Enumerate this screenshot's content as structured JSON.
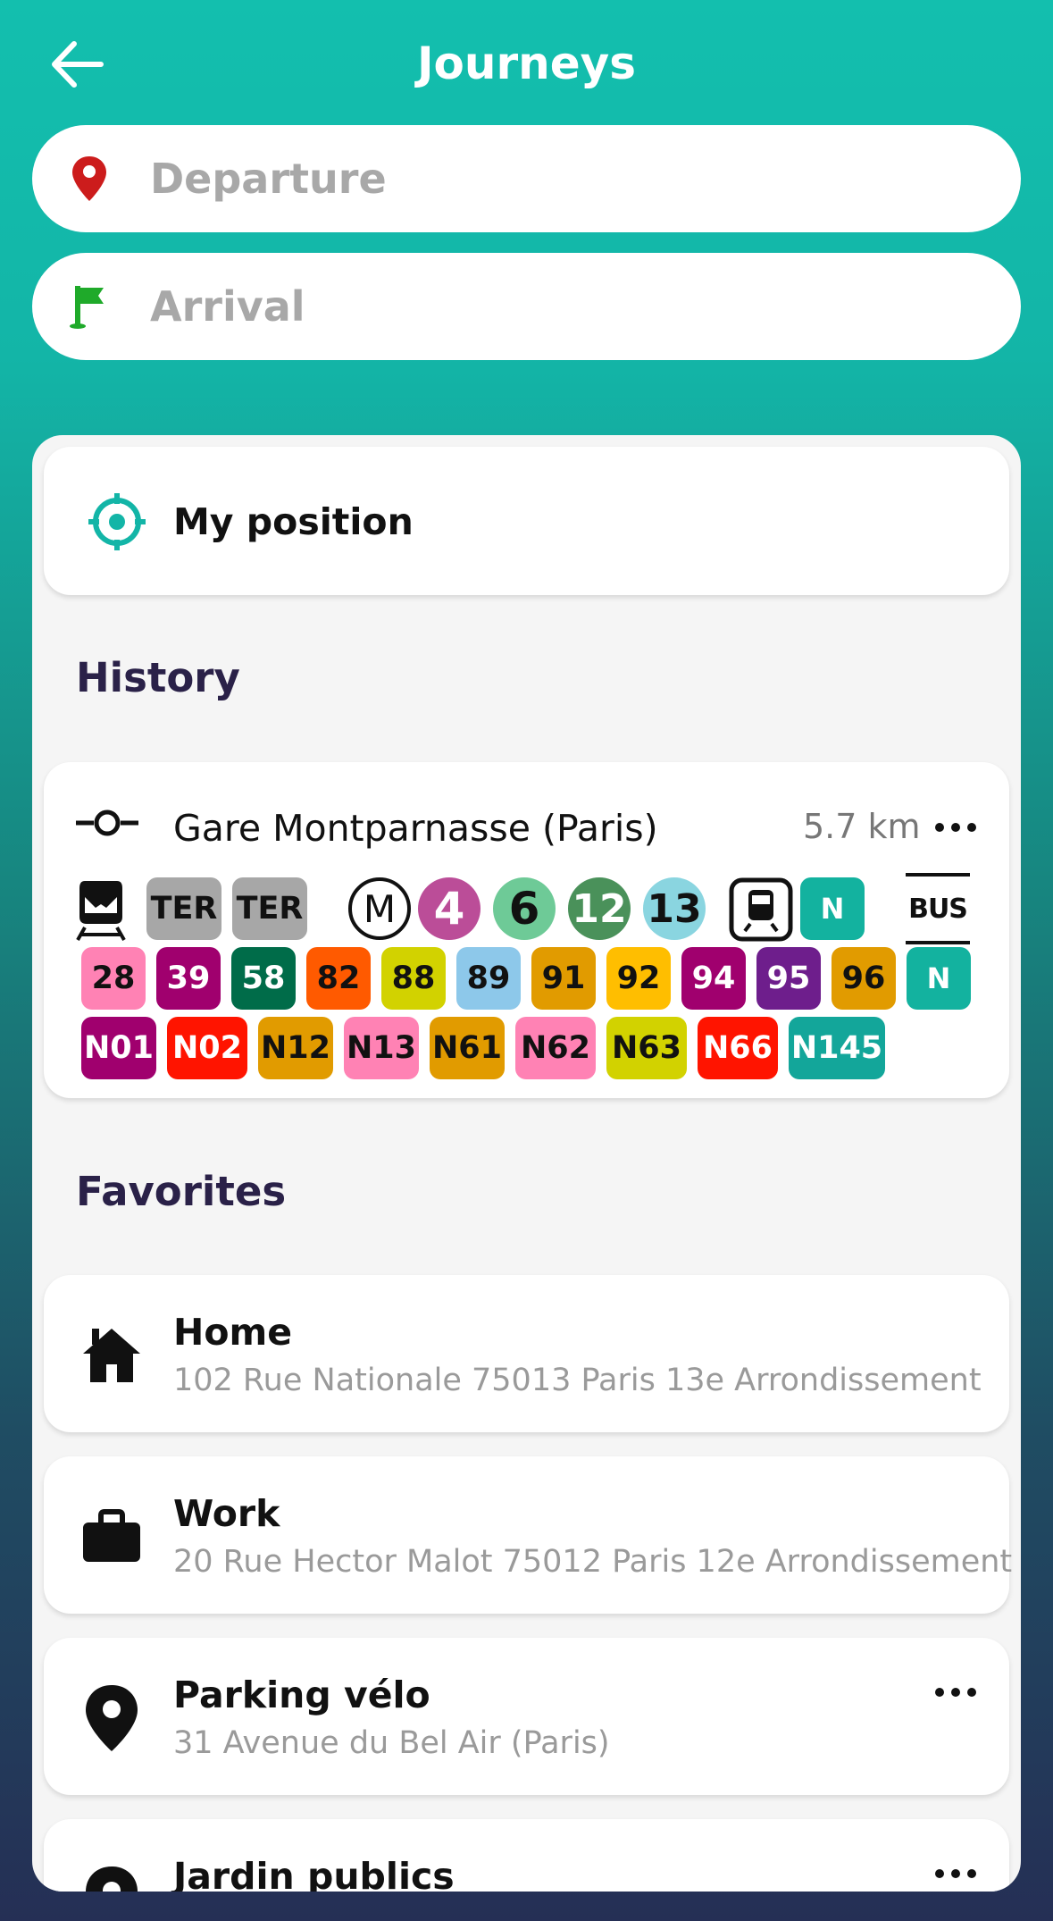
{
  "header": {
    "title": "Journeys",
    "back_icon": "arrow-left-icon"
  },
  "search": {
    "departure_placeholder": "Departure",
    "arrival_placeholder": "Arrival",
    "departure_icon": "map-pin-icon",
    "arrival_icon": "flag-icon"
  },
  "my_position": {
    "label": "My position",
    "icon": "crosshair-icon"
  },
  "history": {
    "title": "History",
    "items": [
      {
        "name": "Gare Montparnasse (Paris)",
        "distance": "5.7 km",
        "icon": "station-icon",
        "rer_lines": [
          "TER",
          "TER"
        ],
        "metro_lines": [
          {
            "label": "4",
            "color": "#bb4d98",
            "text": "#ffffff"
          },
          {
            "label": "6",
            "color": "#6eca97",
            "text": "#111111"
          },
          {
            "label": "12",
            "color": "#4a915a",
            "text": "#ffffff"
          },
          {
            "label": "13",
            "color": "#8ad5e0",
            "text": "#111111"
          }
        ],
        "tram_line": {
          "label": "N",
          "color": "#13b29f"
        },
        "bus_label": "BUS",
        "bus_lines": [
          {
            "label": "28",
            "color": "#ff82b4",
            "text": "#111111"
          },
          {
            "label": "39",
            "color": "#a0006e",
            "text": "#ffffff"
          },
          {
            "label": "58",
            "color": "#006c49",
            "text": "#ffffff"
          },
          {
            "label": "82",
            "color": "#ff5a00",
            "text": "#111111"
          },
          {
            "label": "88",
            "color": "#d2d200",
            "text": "#111111"
          },
          {
            "label": "89",
            "color": "#8dc8ea",
            "text": "#111111"
          },
          {
            "label": "91",
            "color": "#e19b00",
            "text": "#111111"
          },
          {
            "label": "92",
            "color": "#ffbe00",
            "text": "#111111"
          },
          {
            "label": "94",
            "color": "#a0006e",
            "text": "#ffffff"
          },
          {
            "label": "95",
            "color": "#6e1e8c",
            "text": "#ffffff"
          },
          {
            "label": "96",
            "color": "#e19b00",
            "text": "#111111"
          },
          {
            "label": "N",
            "color": "#13b29f",
            "text": "#ffffff"
          }
        ],
        "noctilien_lines": [
          {
            "label": "N01",
            "color": "#a0006e",
            "text": "#ffffff"
          },
          {
            "label": "N02",
            "color": "#ff1400",
            "text": "#ffffff"
          },
          {
            "label": "N12",
            "color": "#e19b00",
            "text": "#111111"
          },
          {
            "label": "N13",
            "color": "#ff82b4",
            "text": "#111111"
          },
          {
            "label": "N61",
            "color": "#e19b00",
            "text": "#111111"
          },
          {
            "label": "N62",
            "color": "#ff82b4",
            "text": "#111111"
          },
          {
            "label": "N63",
            "color": "#d2d200",
            "text": "#111111"
          },
          {
            "label": "N66",
            "color": "#ff1400",
            "text": "#ffffff"
          },
          {
            "label": "N145",
            "color": "#13a69a",
            "text": "#ffffff"
          }
        ]
      }
    ]
  },
  "favorites": {
    "title": "Favorites",
    "items": [
      {
        "name": "Home",
        "address": "102 Rue Nationale 75013 Paris 13e Arrondissement",
        "icon": "home-icon"
      },
      {
        "name": "Work",
        "address": "20 Rue Hector Malot 75012 Paris 12e Arrondissement",
        "icon": "briefcase-icon"
      },
      {
        "name": "Parking vélo",
        "address": "31 Avenue du Bel Air (Paris)",
        "icon": "map-pin-icon"
      },
      {
        "name": "Jardin publics",
        "address": "",
        "icon": "map-pin-icon"
      }
    ]
  },
  "colors": {
    "accent": "#13bfae",
    "section_title": "#2a2148"
  }
}
